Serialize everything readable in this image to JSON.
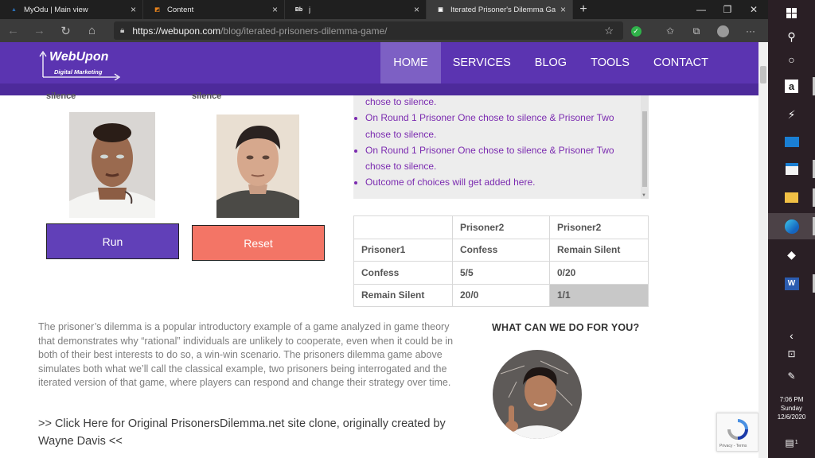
{
  "browser": {
    "tabs": [
      {
        "title": "MyOdu | Main view",
        "favicon": "myodu-icon",
        "color": "#2c6fb5",
        "glyph": "▲",
        "active": false
      },
      {
        "title": "Content",
        "favicon": "content-icon",
        "color": "#e8831c",
        "glyph": "◩",
        "active": false
      },
      {
        "title": "j",
        "favicon": "blackboard-icon",
        "color": "#222222",
        "glyph": "Bb",
        "active": false
      },
      {
        "title": "Iterated Prisoner's Dilemma Gam",
        "favicon": "webupon-icon",
        "color": "#ffffff",
        "glyph": "▣",
        "active": true
      }
    ],
    "url_host": "https://webupon.com",
    "url_path": "/blog/iterated-prisoners-dilemma-game/"
  },
  "site": {
    "logo_main": "WebUpon",
    "logo_sub": "Digital Marketing",
    "nav": [
      "HOME",
      "SERVICES",
      "BLOG",
      "TOOLS",
      "CONTACT"
    ],
    "nav_active": "HOME",
    "brand_color": "#5b34b1"
  },
  "game": {
    "cut_label_left": "silence",
    "cut_label_right": "silence",
    "run_label": "Run",
    "reset_label": "Reset",
    "outcomes": [
      "chose to silence.",
      "On Round 1 Prisoner One chose to silence & Prisoner Two chose to silence.",
      "On Round 1 Prisoner One chose to silence & Prisoner Two chose to silence.",
      "Outcome of choices will get added here."
    ],
    "table": [
      [
        "",
        "Prisoner2",
        "Prisoner2"
      ],
      [
        "Prisoner1",
        "Confess",
        "Remain Silent"
      ],
      [
        "Confess",
        "5/5",
        "0/20"
      ],
      [
        "Remain Silent",
        "20/0",
        "1/1"
      ]
    ]
  },
  "article": {
    "paragraph": "The prisoner’s dilemma is a popular introductory example of a game analyzed in game theory that demonstrates why “rational” individuals are unlikely to cooperate, even when it could be in both of their best interests to do so, a win-win scenario. The prisoners dilemma game above simulates both what we’ll call the classical example, two prisoners being interrogated and the iterated version of that game, where players can respond and change their strategy over time.",
    "clone_link": ">> Click Here for Original PrisonersDilemma.net site clone, originally created by Wayne Davis <<",
    "aside_title": "WHAT CAN WE DO FOR YOU?"
  },
  "recaptcha": {
    "text": "Privacy - Terms"
  },
  "taskbar": {
    "time": "7:06 PM",
    "day": "Sunday",
    "date": "12/6/2020",
    "notifications": "1"
  }
}
